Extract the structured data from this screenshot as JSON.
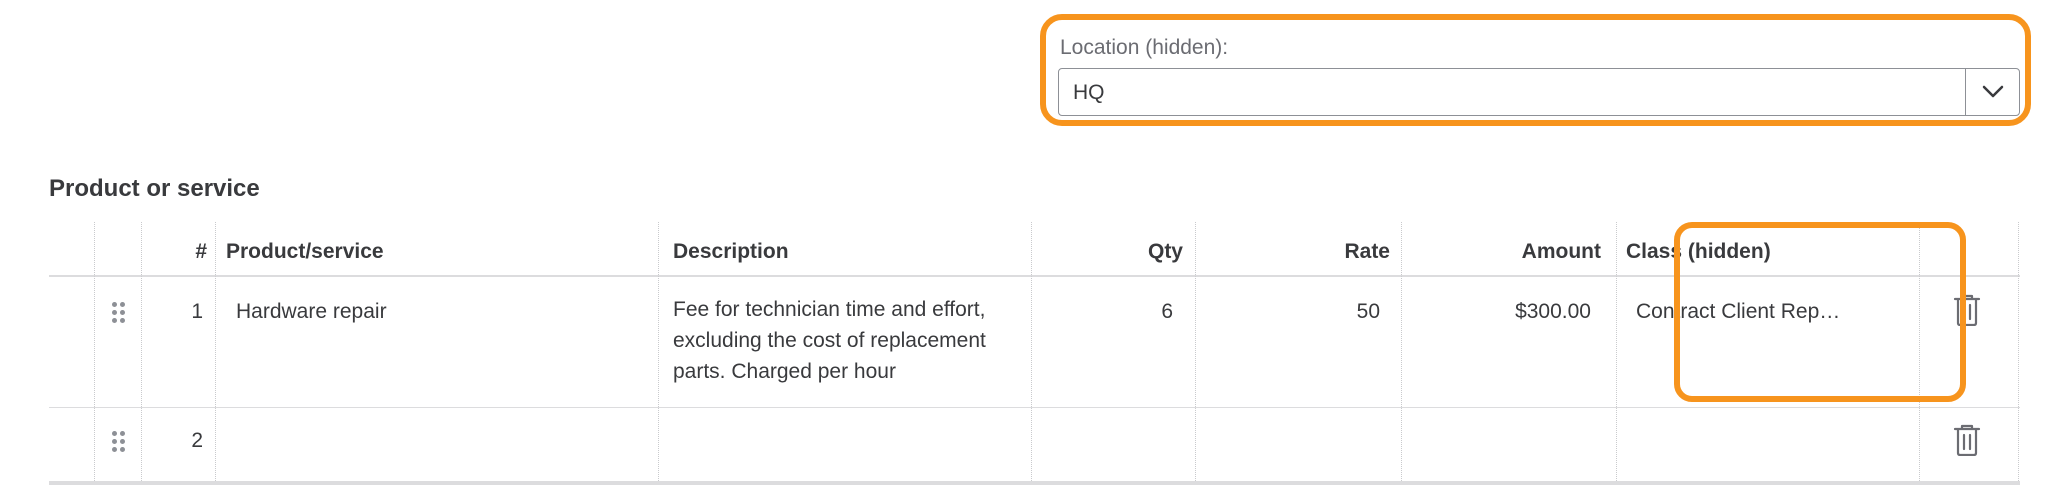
{
  "location": {
    "label": "Location (hidden):",
    "value": "HQ",
    "dropdown_icon": "chevron-down-icon"
  },
  "section": {
    "title": "Product or service"
  },
  "table": {
    "columns": {
      "num": "#",
      "product": "Product/service",
      "description": "Description",
      "qty": "Qty",
      "rate": "Rate",
      "amount": "Amount",
      "class": "Class (hidden)"
    },
    "rows": [
      {
        "num": "1",
        "product": "Hardware repair",
        "description_lines": [
          "Fee for technician time and effort,",
          "excluding the cost of replacement",
          "parts. Charged per hour"
        ],
        "qty": "6",
        "rate": "50",
        "amount": "$300.00",
        "class": "Contract Client Rep…"
      },
      {
        "num": "2",
        "product": "",
        "description_lines": [],
        "qty": "",
        "rate": "",
        "amount": "",
        "class": ""
      }
    ]
  },
  "colors": {
    "highlight": "#f7941d",
    "text": "#393a3d",
    "muted": "#6b6c72"
  },
  "icons": {
    "drag": "drag-handle-icon",
    "delete": "trash-icon"
  }
}
